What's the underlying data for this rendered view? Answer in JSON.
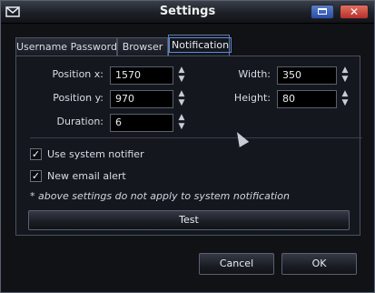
{
  "window": {
    "title": "Settings",
    "close_glyph": "✕"
  },
  "tabs": [
    {
      "label": "Username Password",
      "active": false
    },
    {
      "label": "Browser",
      "active": false
    },
    {
      "label": "Notification",
      "active": true
    }
  ],
  "fields": {
    "position_x": {
      "label": "Position x:",
      "value": "1570"
    },
    "position_y": {
      "label": "Position y:",
      "value": "970"
    },
    "duration": {
      "label": "Duration:",
      "value": "6"
    },
    "width": {
      "label": "Width:",
      "value": "350"
    },
    "height": {
      "label": "Height:",
      "value": "80"
    }
  },
  "arrows": {
    "up": "▲",
    "down": "▼"
  },
  "checkboxes": {
    "use_system_notifier": {
      "label": "Use system notifier",
      "checked": true,
      "mark": "✓"
    },
    "new_email_alert": {
      "label": "New email alert",
      "checked": true,
      "mark": "✓"
    }
  },
  "note": "* above settings do not apply to system notification",
  "buttons": {
    "test": "Test",
    "cancel": "Cancel",
    "ok": "OK"
  },
  "colors": {
    "accent": "#2a4ea8",
    "close": "#b8302a",
    "background": "#14171d"
  },
  "icons": {
    "app": "mail-icon",
    "maximize": "maximize-icon",
    "close": "close-icon"
  }
}
